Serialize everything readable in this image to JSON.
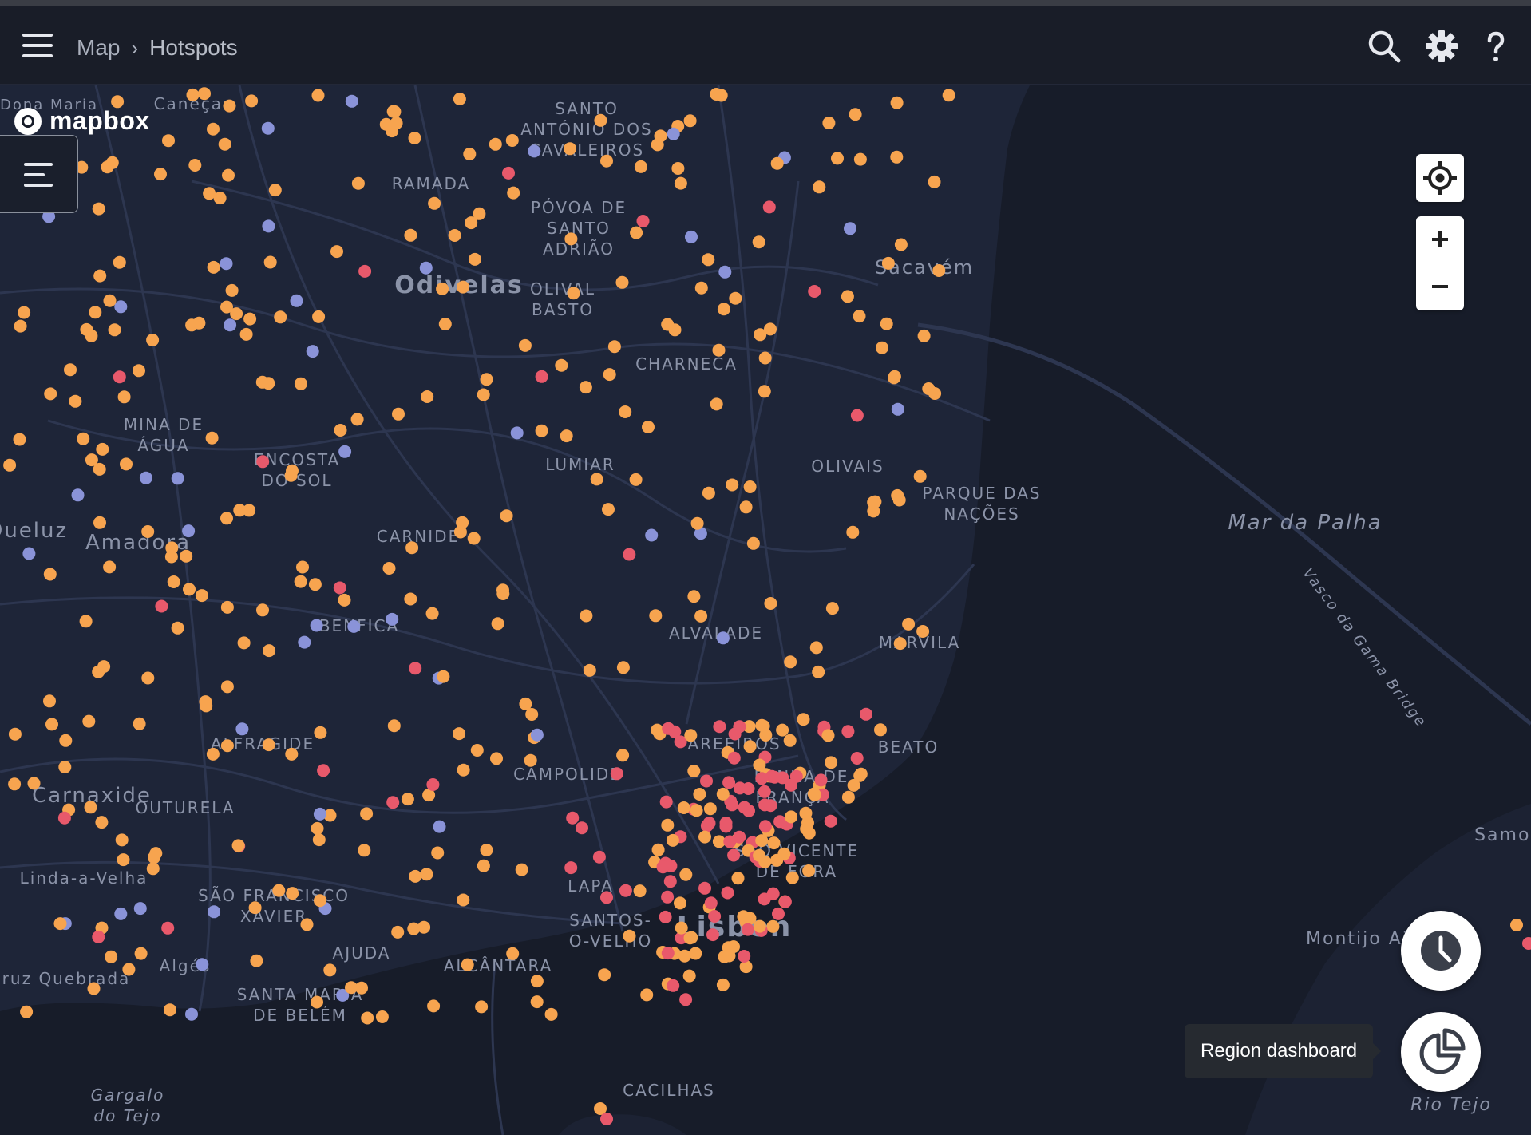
{
  "header": {
    "menu_icon": "hamburger-menu-icon",
    "breadcrumb": [
      "Map",
      "Hotspots"
    ],
    "actions": [
      {
        "name": "search",
        "icon": "search-icon"
      },
      {
        "name": "settings",
        "icon": "gear-icon"
      },
      {
        "name": "help",
        "icon": "help-icon"
      }
    ]
  },
  "map": {
    "provider_logo": "mapbox",
    "colors": {
      "water": "#171c29",
      "land": "#1e2538",
      "road": "#2d3650",
      "hotspot_high": "#e8596b",
      "hotspot_mid": "#f7a44f",
      "hotspot_low": "#8a93d8"
    },
    "labels": [
      {
        "text": "Dona Maria",
        "kind": "locality"
      },
      {
        "text": "Caneças",
        "kind": "locality"
      },
      {
        "text": "SANTO",
        "kind": "district"
      },
      {
        "text": "ANTÓNIO DOS",
        "kind": "district"
      },
      {
        "text": "CAVALEIROS",
        "kind": "district"
      },
      {
        "text": "RAMADA",
        "kind": "district"
      },
      {
        "text": "PÓVOA DE",
        "kind": "district"
      },
      {
        "text": "SANTO",
        "kind": "district"
      },
      {
        "text": "ADRIÃO",
        "kind": "district"
      },
      {
        "text": "Odivelas",
        "kind": "city"
      },
      {
        "text": "OLIVAL",
        "kind": "district"
      },
      {
        "text": "BASTO",
        "kind": "district"
      },
      {
        "text": "Sacavém",
        "kind": "locality"
      },
      {
        "text": "CHARNECA",
        "kind": "district"
      },
      {
        "text": "MINA DE",
        "kind": "district"
      },
      {
        "text": "ÁGUA",
        "kind": "district"
      },
      {
        "text": "ENCOSTA",
        "kind": "district"
      },
      {
        "text": "DO SOL",
        "kind": "district"
      },
      {
        "text": "LUMIAR",
        "kind": "district"
      },
      {
        "text": "OLIVAIS",
        "kind": "district"
      },
      {
        "text": "PARQUE DAS",
        "kind": "district"
      },
      {
        "text": "NAÇÕES",
        "kind": "district"
      },
      {
        "text": "Mar da Palha",
        "kind": "water"
      },
      {
        "text": "Queluz",
        "kind": "locality"
      },
      {
        "text": "Amadora",
        "kind": "locality"
      },
      {
        "text": "CARNIDE",
        "kind": "district"
      },
      {
        "text": "BENFICA",
        "kind": "district"
      },
      {
        "text": "ALVALADE",
        "kind": "district"
      },
      {
        "text": "MARVILA",
        "kind": "district"
      },
      {
        "text": "Vasco da Gama Bridge",
        "kind": "road"
      },
      {
        "text": "ALFRAGIDE",
        "kind": "district"
      },
      {
        "text": "AREEIROS",
        "kind": "district"
      },
      {
        "text": "BEATO",
        "kind": "district"
      },
      {
        "text": "CAMPOLIDE",
        "kind": "district"
      },
      {
        "text": "Carnaxide",
        "kind": "locality"
      },
      {
        "text": "OUTURELA",
        "kind": "district"
      },
      {
        "text": "PENHA DE",
        "kind": "district"
      },
      {
        "text": "FRANÇA",
        "kind": "district"
      },
      {
        "text": "Samouco",
        "kind": "locality"
      },
      {
        "text": "SÃO VICENTE",
        "kind": "district"
      },
      {
        "text": "DE FORA",
        "kind": "district"
      },
      {
        "text": "Linda-a-Velha",
        "kind": "locality"
      },
      {
        "text": "SÃO FRANCISCO",
        "kind": "district"
      },
      {
        "text": "XAVIER",
        "kind": "district"
      },
      {
        "text": "LAPA",
        "kind": "district"
      },
      {
        "text": "SANTOS-",
        "kind": "district"
      },
      {
        "text": "O-VELHO",
        "kind": "district"
      },
      {
        "text": "Lisbon",
        "kind": "capital"
      },
      {
        "text": "Montijo Air",
        "kind": "locality"
      },
      {
        "text": "AJUDA",
        "kind": "district"
      },
      {
        "text": "ALCÂNTARA",
        "kind": "district"
      },
      {
        "text": "Cruz Quebrada",
        "kind": "locality"
      },
      {
        "text": "Algés",
        "kind": "locality"
      },
      {
        "text": "SANTA MARIA",
        "kind": "district"
      },
      {
        "text": "DE BELÉM",
        "kind": "district"
      },
      {
        "text": "CACILHAS",
        "kind": "district"
      },
      {
        "text": "Gargalo",
        "kind": "water"
      },
      {
        "text": "do Tejo",
        "kind": "water"
      },
      {
        "text": "Rio Tejo",
        "kind": "water"
      }
    ]
  },
  "controls": {
    "layers_icon": "layers-menu-icon",
    "locate_icon": "locate-crosshair-icon",
    "zoom_in_icon": "plus-icon",
    "zoom_out_icon": "minus-icon"
  },
  "fabs": [
    {
      "name": "history",
      "icon": "clock-icon"
    },
    {
      "name": "region-dashboard",
      "icon": "pie-chart-icon"
    }
  ],
  "tooltip": {
    "text": "Region dashboard"
  }
}
